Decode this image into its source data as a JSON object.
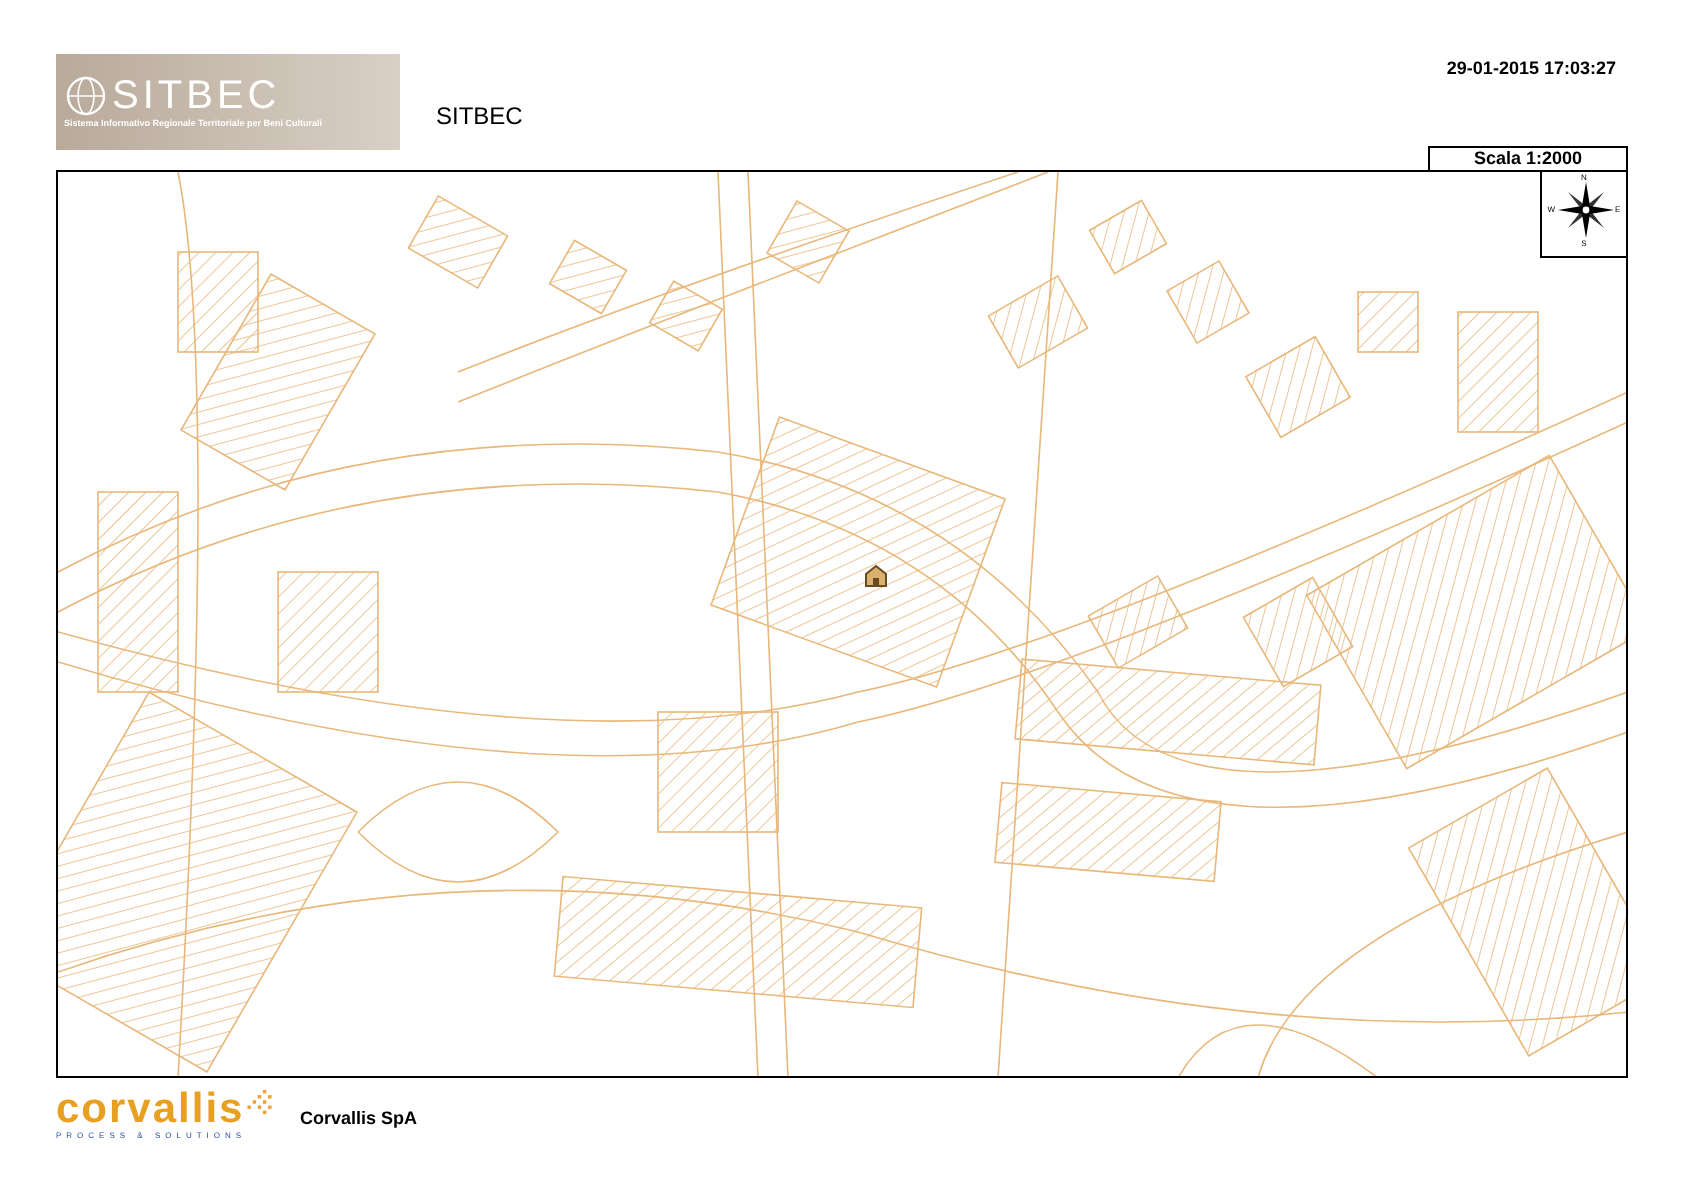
{
  "header": {
    "logo": {
      "name": "SITBEC",
      "subtitle": "Sistema Informativo Regionale Territoriale per Beni Culturali"
    },
    "title": "SITBEC",
    "timestamp": "29-01-2015 17:03:27"
  },
  "map": {
    "scale": "Scala 1:2000",
    "compass": {
      "north": "N",
      "east": "E",
      "south": "S",
      "west": "W"
    }
  },
  "footer": {
    "logo": {
      "name": "corvallis",
      "tagline": "PROCESS & SOLUTIONS"
    },
    "company": "Corvallis SpA"
  }
}
